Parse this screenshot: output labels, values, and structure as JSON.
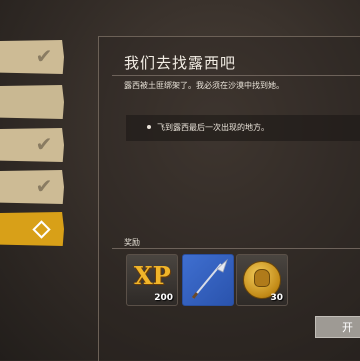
{
  "quest_list": {
    "items": [
      {
        "state": "completed"
      },
      {
        "state": "in-progress"
      },
      {
        "state": "completed"
      },
      {
        "state": "completed"
      },
      {
        "state": "selected"
      }
    ]
  },
  "quest": {
    "title": "我们去找露西吧",
    "description": "露西被土匪绑架了。我必须在沙漠中找到她。",
    "objective": "飞到露西最后一次出现的地方。"
  },
  "rewards": {
    "label": "奖励",
    "items": [
      {
        "icon": "xp-icon",
        "quantity": "200"
      },
      {
        "icon": "spear-icon",
        "quantity": ""
      },
      {
        "icon": "gold-coin-icon",
        "quantity": "30"
      }
    ],
    "xp_glyph": "XP"
  },
  "action": {
    "label": "开"
  },
  "colors": {
    "accent": "#d8a018",
    "quest_item": "#cdbb95",
    "spear_bg": "#3f6fd0",
    "coin": "#e0a93a"
  }
}
